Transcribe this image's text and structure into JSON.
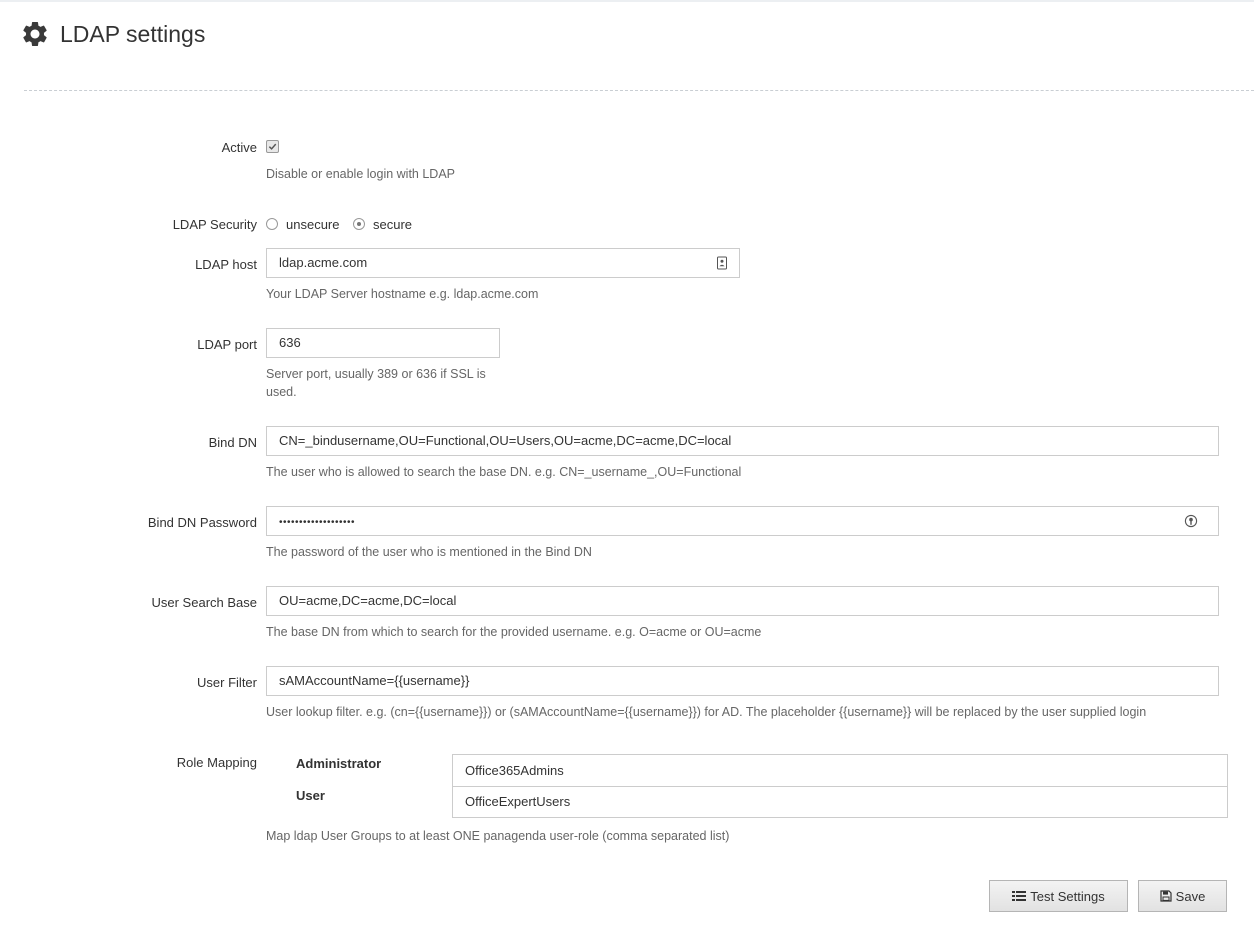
{
  "page": {
    "title": "LDAP settings",
    "icon": "gear-icon"
  },
  "form": {
    "active": {
      "label": "Active",
      "checked": true,
      "help": "Disable or enable login with LDAP"
    },
    "security": {
      "label": "LDAP Security",
      "options": [
        {
          "label": "unsecure",
          "selected": false
        },
        {
          "label": "secure",
          "selected": true
        }
      ]
    },
    "host": {
      "label": "LDAP host",
      "value": "ldap.acme.com",
      "help": "Your LDAP Server hostname e.g. ldap.acme.com",
      "icon": "contact-card-icon"
    },
    "port": {
      "label": "LDAP port",
      "value": "636",
      "help_line1": "Server port, usually 389 or 636 if SSL is",
      "help_line2": "used."
    },
    "bind_dn": {
      "label": "Bind DN",
      "value": "CN=_bindusername,OU=Functional,OU=Users,OU=acme,DC=acme,DC=local",
      "help": "The user who is allowed to search the base DN. e.g. CN=_username_,OU=Functional"
    },
    "bind_password": {
      "label": "Bind DN Password",
      "value": "•••••••••••••••••••",
      "help": "The password of the user who is mentioned in the Bind DN",
      "icon": "key-icon"
    },
    "search_base": {
      "label": "User Search Base",
      "value": "OU=acme,DC=acme,DC=local",
      "help": "The base DN from which to search for the provided username. e.g. O=acme or OU=acme"
    },
    "user_filter": {
      "label": "User Filter",
      "value": "sAMAccountName={{username}}",
      "help": "User lookup filter. e.g. (cn={{username}}) or (sAMAccountName={{username}}) for AD. The placeholder {{username}} will be replaced by the user supplied login"
    },
    "role_mapping": {
      "label": "Role Mapping",
      "roles": [
        {
          "name": "Administrator",
          "value": "Office365Admins"
        },
        {
          "name": "User",
          "value": "OfficeExpertUsers"
        }
      ],
      "help": "Map ldap User Groups to at least ONE panagenda user-role (comma separated list)"
    }
  },
  "actions": {
    "test_label": "Test Settings",
    "save_label": "Save"
  }
}
